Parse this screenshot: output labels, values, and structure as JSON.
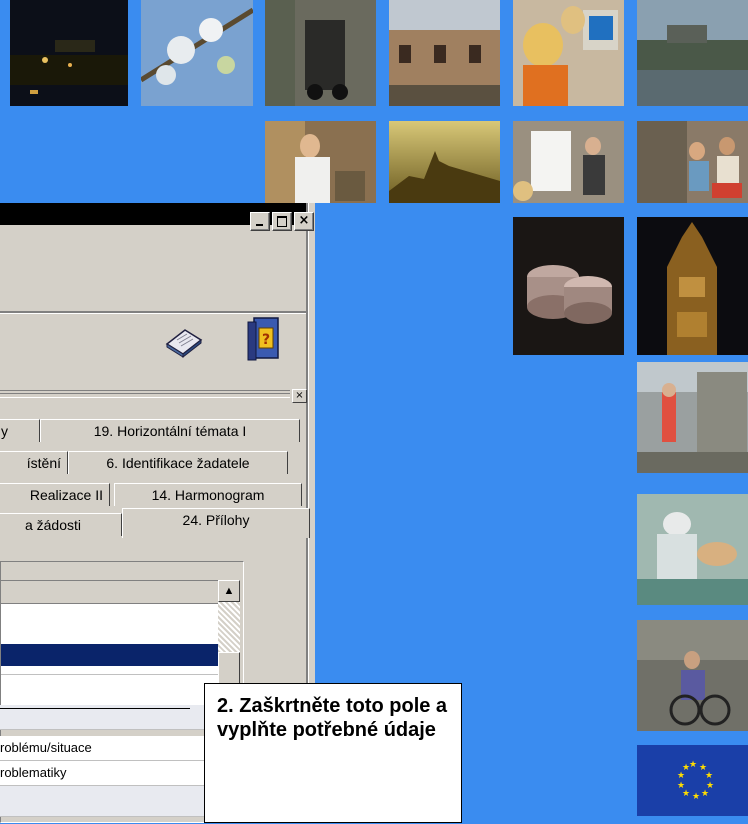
{
  "window": {
    "tabs": [
      {
        "label": "y"
      },
      {
        "label": "19. Horizontální témata I"
      },
      {
        "label": "ístění"
      },
      {
        "label": "6. Identifikace žadatele"
      },
      {
        "label": "Realizace II"
      },
      {
        "label": "14. Harmonogram"
      },
      {
        "label": "a žádosti"
      },
      {
        "label": "24. Přílohy"
      }
    ],
    "rows": [
      {
        "text": "roblému/situace"
      },
      {
        "text": "roblematiky"
      }
    ]
  },
  "callout": {
    "text": "2. Zaškrtněte toto pole a vyplňte potřebné údaje"
  },
  "colors": {
    "background": "#3a8cf0",
    "selection": "#0a246a"
  }
}
